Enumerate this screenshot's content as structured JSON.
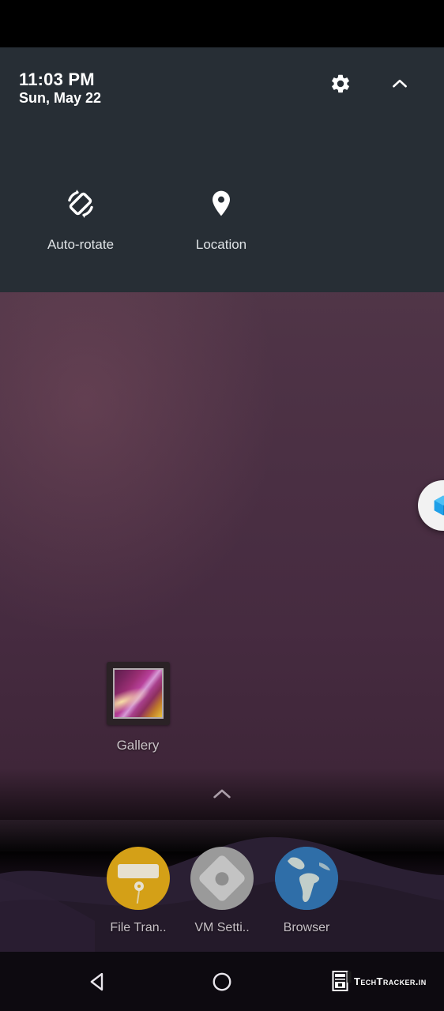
{
  "status_bar": {
    "background": "#000000"
  },
  "quick_settings": {
    "background": "#272e35",
    "clock": "11:03 PM",
    "date": "Sun, May 22",
    "settings_icon": "gear-icon",
    "collapse_icon": "chevron-up-icon",
    "tiles": [
      {
        "label": "Auto-rotate",
        "icon": "auto-rotate-icon",
        "state": "on"
      },
      {
        "label": "Location",
        "icon": "location-pin-icon",
        "state": "on"
      }
    ]
  },
  "home": {
    "apps": [
      {
        "label": "Gallery",
        "icon": "gallery-icon"
      }
    ],
    "drawer_indicator_icon": "chevron-up-icon",
    "floating_bubble": {
      "icon": "virtualbox-cube-icon",
      "color": "#2196f3"
    }
  },
  "dock": {
    "apps": [
      {
        "label": "File Tran..",
        "icon": "file-transfer-icon",
        "color": "#d4a017"
      },
      {
        "label": "VM Setti..",
        "icon": "vm-settings-icon",
        "color": "#9a9a9a"
      },
      {
        "label": "Browser",
        "icon": "browser-globe-icon",
        "color": "#2f6ea8"
      }
    ]
  },
  "navigation_bar": {
    "background": "#0d0a10",
    "buttons": [
      {
        "name": "back",
        "icon": "back-triangle-icon"
      },
      {
        "name": "home",
        "icon": "home-circle-icon"
      },
      {
        "name": "recents",
        "icon": "recents-square-icon"
      }
    ]
  },
  "watermark": {
    "text": "TechTracker.in",
    "logo_icon": "techtracker-logo-icon"
  },
  "wallpaper": {
    "top_color": "#5e4252",
    "mid_color": "#4a2f43",
    "bottom_color": "#241a2a"
  }
}
